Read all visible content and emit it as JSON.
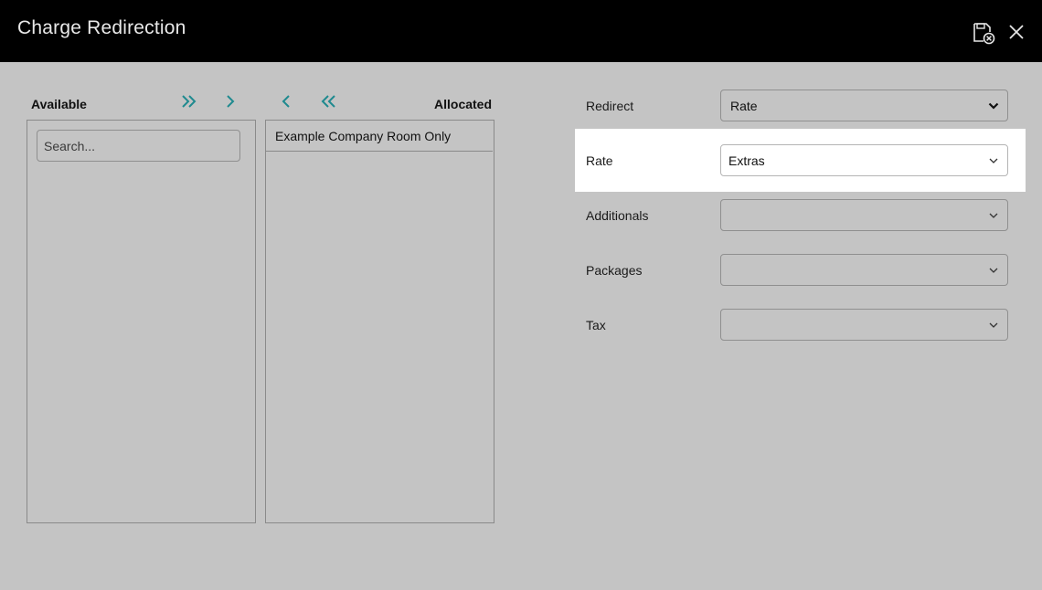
{
  "dialog": {
    "title": "Charge Redirection"
  },
  "icons": {
    "save": "save-cancel-icon",
    "close": "close-icon",
    "move_all_right": "double-chevron-right-icon",
    "move_right": "chevron-right-icon",
    "move_left": "chevron-left-icon",
    "move_all_left": "double-chevron-left-icon",
    "dropdown": "chevron-down-icon"
  },
  "colors": {
    "accent": "#1f8a8f",
    "titlebar": "#000000",
    "background": "#c4c4c4"
  },
  "available": {
    "header": "Available",
    "search_placeholder": "Search...",
    "items": []
  },
  "allocated": {
    "header": "Allocated",
    "items": [
      "Example Company Room Only"
    ]
  },
  "fields": [
    {
      "label": "Redirect",
      "value": "Rate"
    },
    {
      "label": "Rate",
      "value": "Extras"
    },
    {
      "label": "Additionals",
      "value": ""
    },
    {
      "label": "Packages",
      "value": ""
    },
    {
      "label": "Tax",
      "value": ""
    }
  ]
}
